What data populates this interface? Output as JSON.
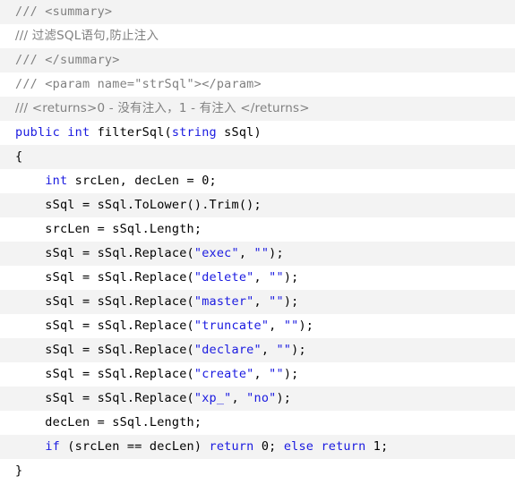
{
  "editor": {
    "language": "csharp",
    "colors": {
      "background": "#ffffff",
      "stripe_background": "#f3f3f3",
      "comment": "#808080",
      "keyword": "#1a1ae0",
      "string": "#1a1ae0",
      "plain_text": "#000000"
    },
    "line_height_px": 27,
    "total_lines": 20
  },
  "code": {
    "lines": [
      {
        "index": 0,
        "stripe": true,
        "tokens": [
          {
            "type": "comment",
            "text": "/// <summary>"
          }
        ]
      },
      {
        "index": 1,
        "stripe": false,
        "tokens": [
          {
            "type": "comment",
            "text": "/// 过滤SQL语句,防止注入"
          }
        ]
      },
      {
        "index": 2,
        "stripe": true,
        "tokens": [
          {
            "type": "comment",
            "text": "/// </summary>"
          }
        ]
      },
      {
        "index": 3,
        "stripe": false,
        "tokens": [
          {
            "type": "comment",
            "text": "/// <param name=\"strSql\"></param>"
          }
        ]
      },
      {
        "index": 4,
        "stripe": true,
        "tokens": [
          {
            "type": "comment",
            "text": "/// <returns>0 - 没有注入，1 - 有注入 </returns>"
          }
        ]
      },
      {
        "index": 5,
        "stripe": false,
        "tokens": [
          {
            "type": "keyword",
            "text": "public"
          },
          {
            "type": "plain",
            "text": " "
          },
          {
            "type": "keyword",
            "text": "int"
          },
          {
            "type": "plain",
            "text": " filterSql("
          },
          {
            "type": "keyword",
            "text": "string"
          },
          {
            "type": "plain",
            "text": " sSql)"
          }
        ]
      },
      {
        "index": 6,
        "stripe": true,
        "tokens": [
          {
            "type": "plain",
            "text": "{"
          }
        ]
      },
      {
        "index": 7,
        "stripe": false,
        "tokens": [
          {
            "type": "plain",
            "text": "    "
          },
          {
            "type": "keyword",
            "text": "int"
          },
          {
            "type": "plain",
            "text": " srcLen, decLen = 0;"
          }
        ]
      },
      {
        "index": 8,
        "stripe": true,
        "tokens": [
          {
            "type": "plain",
            "text": "    sSql = sSql.ToLower().Trim();"
          }
        ]
      },
      {
        "index": 9,
        "stripe": false,
        "tokens": [
          {
            "type": "plain",
            "text": "    srcLen = sSql.Length;"
          }
        ]
      },
      {
        "index": 10,
        "stripe": true,
        "tokens": [
          {
            "type": "plain",
            "text": "    sSql = sSql.Replace("
          },
          {
            "type": "string",
            "text": "\"exec\""
          },
          {
            "type": "plain",
            "text": ", "
          },
          {
            "type": "string",
            "text": "\"\""
          },
          {
            "type": "plain",
            "text": ");"
          }
        ]
      },
      {
        "index": 11,
        "stripe": false,
        "tokens": [
          {
            "type": "plain",
            "text": "    sSql = sSql.Replace("
          },
          {
            "type": "string",
            "text": "\"delete\""
          },
          {
            "type": "plain",
            "text": ", "
          },
          {
            "type": "string",
            "text": "\"\""
          },
          {
            "type": "plain",
            "text": ");"
          }
        ]
      },
      {
        "index": 12,
        "stripe": true,
        "tokens": [
          {
            "type": "plain",
            "text": "    sSql = sSql.Replace("
          },
          {
            "type": "string",
            "text": "\"master\""
          },
          {
            "type": "plain",
            "text": ", "
          },
          {
            "type": "string",
            "text": "\"\""
          },
          {
            "type": "plain",
            "text": ");"
          }
        ]
      },
      {
        "index": 13,
        "stripe": false,
        "tokens": [
          {
            "type": "plain",
            "text": "    sSql = sSql.Replace("
          },
          {
            "type": "string",
            "text": "\"truncate\""
          },
          {
            "type": "plain",
            "text": ", "
          },
          {
            "type": "string",
            "text": "\"\""
          },
          {
            "type": "plain",
            "text": ");"
          }
        ]
      },
      {
        "index": 14,
        "stripe": true,
        "tokens": [
          {
            "type": "plain",
            "text": "    sSql = sSql.Replace("
          },
          {
            "type": "string",
            "text": "\"declare\""
          },
          {
            "type": "plain",
            "text": ", "
          },
          {
            "type": "string",
            "text": "\"\""
          },
          {
            "type": "plain",
            "text": ");"
          }
        ]
      },
      {
        "index": 15,
        "stripe": false,
        "tokens": [
          {
            "type": "plain",
            "text": "    sSql = sSql.Replace("
          },
          {
            "type": "string",
            "text": "\"create\""
          },
          {
            "type": "plain",
            "text": ", "
          },
          {
            "type": "string",
            "text": "\"\""
          },
          {
            "type": "plain",
            "text": ");"
          }
        ]
      },
      {
        "index": 16,
        "stripe": true,
        "tokens": [
          {
            "type": "plain",
            "text": "    sSql = sSql.Replace("
          },
          {
            "type": "string",
            "text": "\"xp_\""
          },
          {
            "type": "plain",
            "text": ", "
          },
          {
            "type": "string",
            "text": "\"no\""
          },
          {
            "type": "plain",
            "text": ");"
          }
        ]
      },
      {
        "index": 17,
        "stripe": false,
        "tokens": [
          {
            "type": "plain",
            "text": "    decLen = sSql.Length;"
          }
        ]
      },
      {
        "index": 18,
        "stripe": true,
        "tokens": [
          {
            "type": "plain",
            "text": "    "
          },
          {
            "type": "keyword",
            "text": "if"
          },
          {
            "type": "plain",
            "text": " (srcLen == decLen) "
          },
          {
            "type": "keyword",
            "text": "return"
          },
          {
            "type": "plain",
            "text": " 0; "
          },
          {
            "type": "keyword",
            "text": "else"
          },
          {
            "type": "plain",
            "text": " "
          },
          {
            "type": "keyword",
            "text": "return"
          },
          {
            "type": "plain",
            "text": " 1;"
          }
        ]
      },
      {
        "index": 19,
        "stripe": false,
        "tokens": [
          {
            "type": "plain",
            "text": "}"
          }
        ]
      }
    ]
  }
}
